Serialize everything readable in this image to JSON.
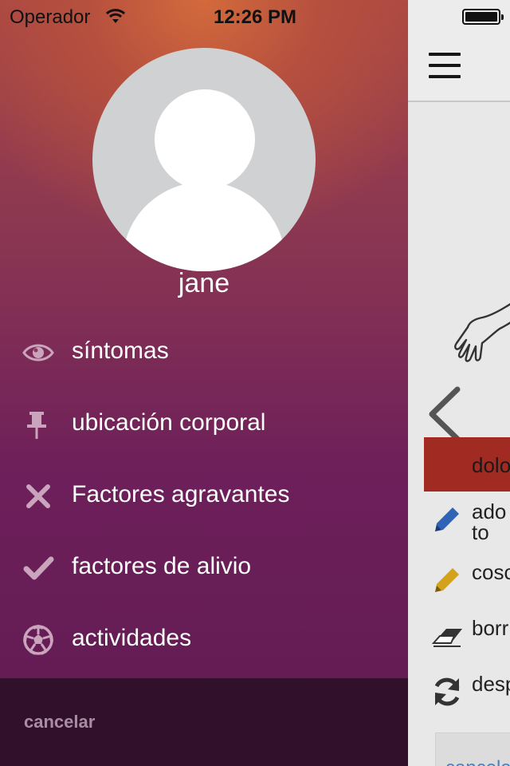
{
  "status_bar": {
    "carrier": "Operador",
    "time": "12:26 PM"
  },
  "drawer": {
    "username": "jane",
    "menu": [
      {
        "label": "síntomas",
        "icon": "eye-icon"
      },
      {
        "label": "ubicación corporal",
        "icon": "pin-icon"
      },
      {
        "label": "Factores agravantes",
        "icon": "x-icon"
      },
      {
        "label": "factores de alivio",
        "icon": "check-icon"
      },
      {
        "label": "actividades",
        "icon": "soccer-ball-icon"
      }
    ],
    "cancel_label": "cancelar"
  },
  "main": {
    "selected_row_label": "dolo",
    "tools": [
      {
        "label": "ado\nto",
        "icon": "pencil-blue-icon"
      },
      {
        "label": "cosc",
        "icon": "pencil-yellow-icon"
      },
      {
        "label": "borr",
        "icon": "eraser-icon"
      },
      {
        "label": "desp",
        "icon": "refresh-icon"
      }
    ],
    "bottom_button_label": "cancela"
  },
  "colors": {
    "drawer_top": "#d36a3c",
    "drawer_bottom": "#611b52",
    "cancel_bar": "#31102b",
    "selected_row": "#a12b22"
  }
}
